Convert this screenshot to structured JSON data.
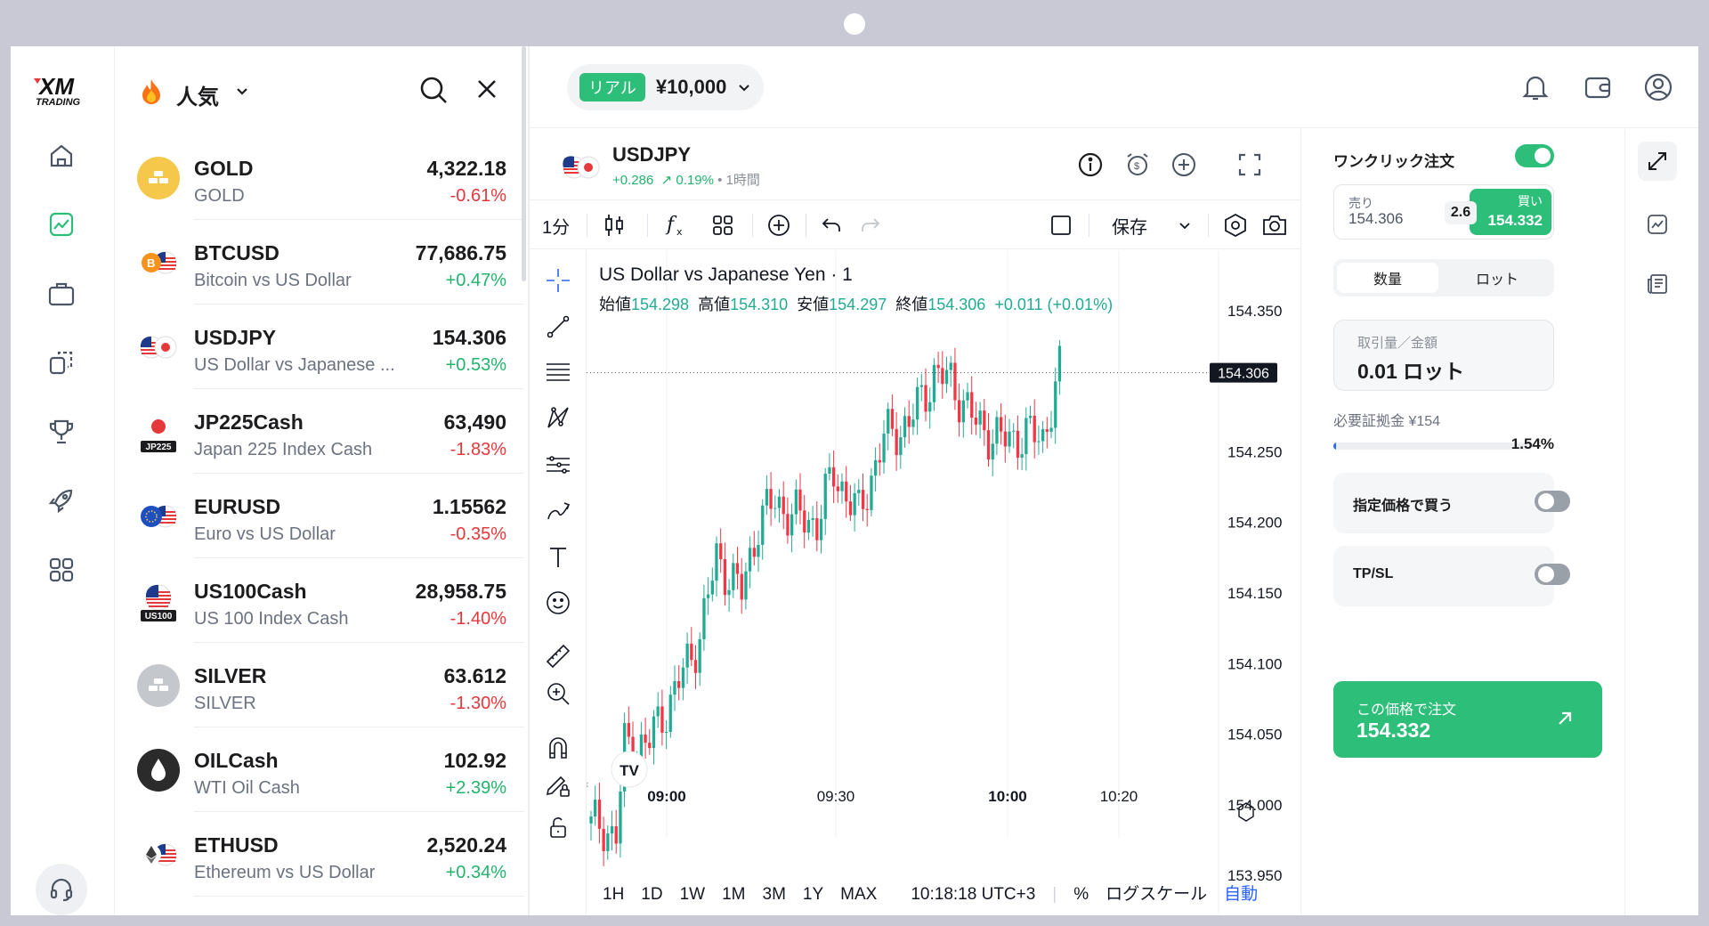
{
  "brand": {
    "name": "XM",
    "sub": "TRADING"
  },
  "nav": {
    "items": [
      "home-icon",
      "chart-icon",
      "briefcase-icon",
      "copy-icon",
      "trophy-icon",
      "rocket-icon",
      "apps-icon"
    ],
    "support": "headset-icon"
  },
  "watchlist": {
    "title": "人気",
    "rows": [
      {
        "symbol": "GOLD",
        "name": "GOLD",
        "price": "4,322.18",
        "change": "-0.61%",
        "dir": "down",
        "icon": "gold-bars-icon"
      },
      {
        "symbol": "BTCUSD",
        "name": "Bitcoin vs US Dollar",
        "price": "77,686.75",
        "change": "+0.47%",
        "dir": "up",
        "icon": "btc-usd-flag-icon"
      },
      {
        "symbol": "USDJPY",
        "name": "US Dollar vs Japanese ...",
        "price": "154.306",
        "change": "+0.53%",
        "dir": "up",
        "icon": "usd-jpy-flag-icon"
      },
      {
        "symbol": "JP225Cash",
        "name": "Japan 225 Index Cash",
        "price": "63,490",
        "change": "-1.83%",
        "dir": "down",
        "icon": "jp225-flag-icon",
        "tag": "JP225"
      },
      {
        "symbol": "EURUSD",
        "name": "Euro vs US Dollar",
        "price": "1.15562",
        "change": "-0.35%",
        "dir": "down",
        "icon": "eur-usd-flag-icon"
      },
      {
        "symbol": "US100Cash",
        "name": "US 100 Index Cash",
        "price": "28,958.75",
        "change": "-1.40%",
        "dir": "down",
        "icon": "us100-flag-icon",
        "tag": "US100"
      },
      {
        "symbol": "SILVER",
        "name": "SILVER",
        "price": "63.612",
        "change": "-1.30%",
        "dir": "down",
        "icon": "silver-bars-icon"
      },
      {
        "symbol": "OILCash",
        "name": "WTI Oil Cash",
        "price": "102.92",
        "change": "+2.39%",
        "dir": "up",
        "icon": "oil-drop-icon"
      },
      {
        "symbol": "ETHUSD",
        "name": "Ethereum vs US Dollar",
        "price": "2,520.24",
        "change": "+0.34%",
        "dir": "up",
        "icon": "eth-usd-flag-icon"
      }
    ]
  },
  "account": {
    "type": "リアル",
    "balance": "¥10,000"
  },
  "chart": {
    "symbol": "USDJPY",
    "change": "+0.286",
    "change_pct": "0.19%",
    "timeframe_label": "• 1時間",
    "interval": "1分",
    "save_label": "保存",
    "title": "US Dollar vs Japanese Yen · 1",
    "ohlc_labels": {
      "open": "始値",
      "high": "高値",
      "low": "安値",
      "close": "終値"
    },
    "ohlc": {
      "open": "154.298",
      "high": "154.310",
      "low": "154.297",
      "close": "154.306",
      "change": "+0.011 (+0.01%)"
    },
    "current_price": "154.306",
    "y_ticks": [
      "154.350",
      "154.250",
      "154.200",
      "154.150",
      "154.100",
      "154.050",
      "154.000",
      "153.950"
    ],
    "x_ticks": [
      "09:00",
      "09:30",
      "10:00",
      "10:20"
    ],
    "ranges": [
      "1H",
      "1D",
      "1W",
      "1M",
      "3M",
      "1Y",
      "MAX"
    ],
    "clock": "10:18:18 UTC+3",
    "pct_label": "%",
    "log_label": "ログスケール",
    "auto_label": "自動",
    "colors": {
      "up": "#22ab94",
      "down": "#f23645",
      "auto": "#2962ff"
    }
  },
  "chart_data": {
    "type": "candlestick",
    "x_range": [
      "08:56",
      "10:23"
    ],
    "ylim": [
      153.94,
      154.36
    ],
    "x_ticks": [
      "09:00",
      "09:30",
      "10:00",
      "10:20"
    ],
    "last_price": 154.306
  },
  "order": {
    "one_click_label": "ワンクリック注文",
    "one_click_on": true,
    "sell_label": "売り",
    "sell_price": "154.306",
    "spread": "2.6",
    "buy_label": "買い",
    "buy_price": "154.332",
    "seg_qty": "数量",
    "seg_lot": "ロット",
    "qty_label": "取引量／金額",
    "qty_value": "0.01 ロット",
    "margin_label": "必要証拠金 ¥154",
    "margin_pct": "1.54%",
    "margin_fraction": 0.0154,
    "limit_label": "指定価格で買う",
    "tpsl_label": "TP/SL",
    "submit_label": "この価格で注文",
    "submit_price": "154.332"
  }
}
